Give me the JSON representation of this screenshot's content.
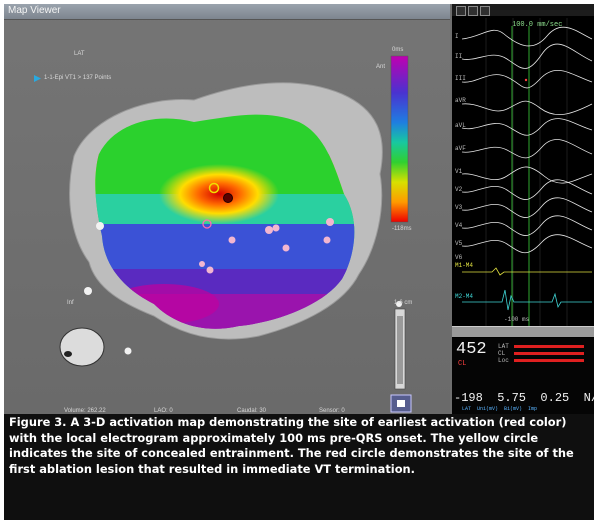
{
  "window": {
    "title": "Map Viewer"
  },
  "map": {
    "label_top": "LAT",
    "map_name": "1-1-Epi VT1 > 137 Points",
    "label_ant": "Ant",
    "label_inf": "Inf",
    "colorbar": {
      "top": "0ms",
      "bottom": "-118ms"
    },
    "window_label": "1-6 cm",
    "status": [
      "Volume: 262.22",
      "LAO: 0",
      "Caudal: 30",
      "Sensor: 0"
    ]
  },
  "egm": {
    "speed": "100.0 mm/sec",
    "leads": [
      "I",
      "II",
      "III",
      "aVR",
      "aVL",
      "aVF",
      "V1",
      "V2",
      "V3",
      "V4",
      "V5",
      "V6",
      "M1-M4",
      "M2-M4"
    ],
    "marker": "-100 ms"
  },
  "readout": {
    "value": "452",
    "value_label": "CL",
    "legend": [
      "LAT",
      "CL",
      "Loc"
    ],
    "stats": "-198  5.75  0.25  N/A",
    "units": "LAT  Uni(mV)  Bi(mV)  Imp"
  },
  "colors": {
    "earliest": "#e00000",
    "latest": "#b0009a",
    "viewer_bg": "#6e6e6e"
  },
  "caption": "Figure 3. A 3-D activation map demonstrating the site of earliest activation (red color) with the local electrogram approximately 100 ms pre-QRS onset. The yellow circle indicates the site of concealed entrainment. The red circle demonstrates the site of the first ablation lesion that resulted in immediate VT termination."
}
